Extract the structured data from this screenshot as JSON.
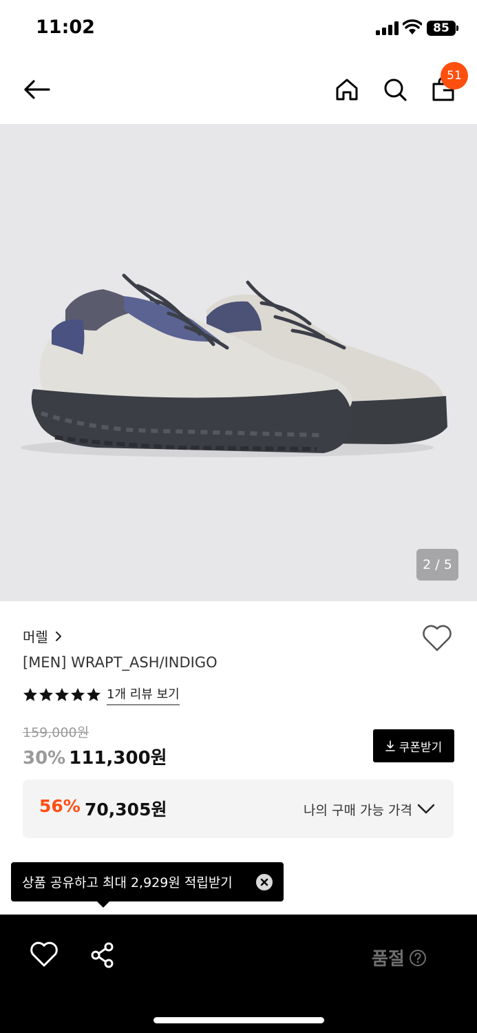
{
  "status_bar": {
    "time": "11:02",
    "battery": "85"
  },
  "nav": {
    "cart_count": "51"
  },
  "gallery": {
    "counter": "2 / 5"
  },
  "product": {
    "brand": "머렐",
    "name": "[MEN] WRAPT_ASH/INDIGO",
    "rating_stars": 5,
    "review_link": "1개 리뷰 보기",
    "original_price": "159,000원",
    "discount_rate": "30%",
    "sale_price": "111,300원",
    "coupon_label": "쿠폰받기"
  },
  "best_price": {
    "rate": "56%",
    "price": "70,305원",
    "label": "나의 구매 가능 가격"
  },
  "tooltip": {
    "text": "상품 공유하고 최대 2,929원 적립받기"
  },
  "bottom_bar": {
    "status": "품절"
  },
  "colors": {
    "accent": "#ff4f0f",
    "discount_gray": "#9a9a9a",
    "best_rate": "#ff4d14"
  }
}
